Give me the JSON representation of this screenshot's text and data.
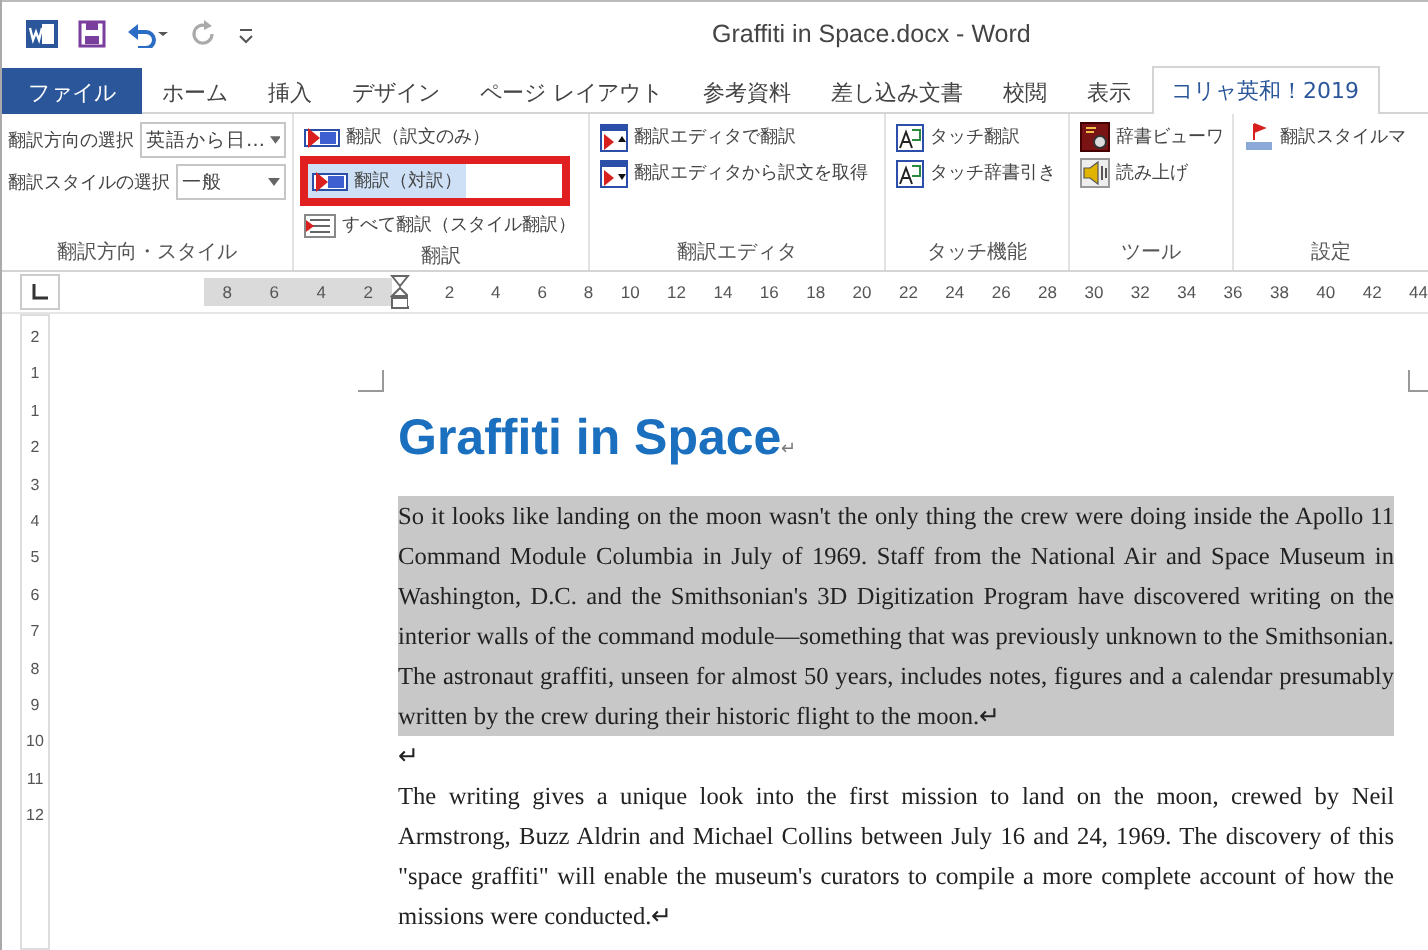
{
  "window": {
    "title": "Graffiti in Space.docx - Word"
  },
  "tabs": [
    {
      "label": "ファイル",
      "kind": "file",
      "selected": false
    },
    {
      "label": "ホーム",
      "kind": "tab",
      "selected": false
    },
    {
      "label": "挿入",
      "kind": "tab",
      "selected": false
    },
    {
      "label": "デザイン",
      "kind": "tab",
      "selected": false
    },
    {
      "label": "ページ レイアウト",
      "kind": "tab",
      "selected": false
    },
    {
      "label": "参考資料",
      "kind": "tab",
      "selected": false
    },
    {
      "label": "差し込み文書",
      "kind": "tab",
      "selected": false
    },
    {
      "label": "校閲",
      "kind": "tab",
      "selected": false
    },
    {
      "label": "表示",
      "kind": "tab",
      "selected": false
    },
    {
      "label": "コリャ英和！2019",
      "kind": "tab",
      "selected": true
    }
  ],
  "ribbon": {
    "groups": [
      {
        "label": "翻訳方向・スタイル",
        "items": [
          {
            "kind": "dropdown",
            "label": "翻訳方向の選択",
            "value": "英語から日…"
          },
          {
            "kind": "dropdown",
            "label": "翻訳スタイルの選択",
            "value": "一般"
          }
        ]
      },
      {
        "label": "翻訳",
        "items": [
          {
            "kind": "button",
            "label": "翻訳（訳文のみ）",
            "highlighted": false
          },
          {
            "kind": "button",
            "label": "翻訳（対訳）",
            "highlighted": true
          },
          {
            "kind": "button",
            "label": "すべて翻訳（スタイル翻訳）",
            "highlighted": false
          }
        ]
      },
      {
        "label": "翻訳エディタ",
        "items": [
          {
            "kind": "button",
            "label": "翻訳エディタで翻訳",
            "highlighted": false
          },
          {
            "kind": "button",
            "label": "翻訳エディタから訳文を取得",
            "highlighted": false
          }
        ]
      },
      {
        "label": "タッチ機能",
        "items": [
          {
            "kind": "button",
            "label": "タッチ翻訳",
            "highlighted": false
          },
          {
            "kind": "button",
            "label": "タッチ辞書引き",
            "highlighted": false
          }
        ]
      },
      {
        "label": "ツール",
        "items": [
          {
            "kind": "button",
            "label": "辞書ビューワ",
            "highlighted": false
          },
          {
            "kind": "button",
            "label": "読み上げ",
            "highlighted": false
          }
        ]
      },
      {
        "label": "設定",
        "items": [
          {
            "kind": "button",
            "label": "翻訳スタイルマ",
            "highlighted": false
          }
        ]
      }
    ]
  },
  "ruler": {
    "left_numbers": [
      "8",
      "6",
      "4",
      "2"
    ],
    "right_numbers": [
      "2",
      "4",
      "6",
      "8",
      "10",
      "12",
      "14",
      "16",
      "18",
      "20",
      "22",
      "24",
      "26",
      "28",
      "30",
      "32",
      "34",
      "36",
      "38",
      "40",
      "42",
      "44"
    ],
    "vertical_numbers": [
      "2",
      "1",
      "1",
      "2",
      "3",
      "4",
      "5",
      "6",
      "7",
      "8",
      "9",
      "10",
      "11",
      "12"
    ]
  },
  "document": {
    "heading": {
      "text": "Graffiti in Space",
      "end_mark": "↵"
    },
    "paragraphs": [
      {
        "text": "So it looks like landing on the moon wasn't the only thing the crew were doing inside the Apollo 11 Command Module Columbia in July of 1969. Staff from the National Air and Space Museum in Washington, D.C. and the Smithsonian's 3D Digitization Program have discovered writing on the interior walls of the command module—something that was previously unknown to the Smithsonian. The astronaut graffiti, unseen for almost 50 years, includes notes, figures and a calendar presumably written by the crew during their historic flight to the moon.↵",
        "selected": true
      },
      {
        "text": "↵",
        "selected": false
      },
      {
        "text": "The writing gives a unique look into the first mission to land on the moon, crewed by Neil Armstrong, Buzz Aldrin and Michael Collins between July 16 and 24, 1969. The discovery of this \"space graffiti\" will enable the museum's curators to compile a more complete account of how the missions were conducted.↵",
        "selected": false
      }
    ]
  }
}
